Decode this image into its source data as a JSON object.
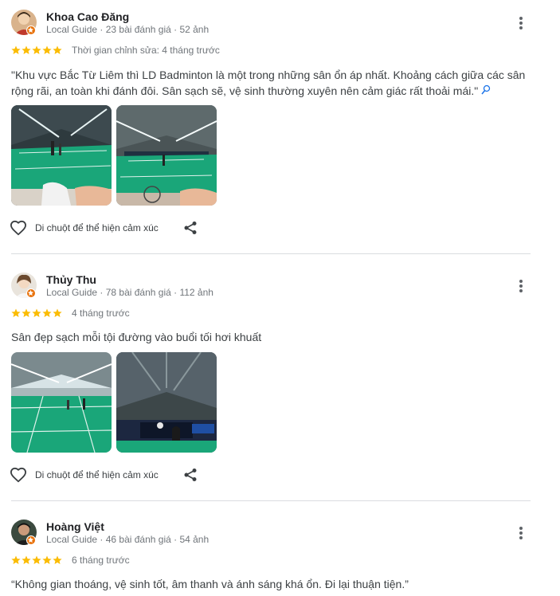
{
  "reviews": [
    {
      "name": "Khoa Cao Đăng",
      "meta": "Local Guide · 23 bài đánh giá · 52 ảnh",
      "rating": 5,
      "time": "Thời gian chỉnh sửa: 4 tháng trước",
      "text": "\"Khu vực Bắc Từ Liêm thì LD Badminton là một trong những sân ổn áp nhất. Khoảng cách giữa các sân rộng rãi, an toàn khi đánh đôi. Sân sạch sẽ, vệ sinh thường xuyên nên cảm giác rất thoải mái.\"",
      "like_label": "Di chuột để thể hiện cảm xúc"
    },
    {
      "name": "Thủy Thu",
      "meta": "Local Guide · 78 bài đánh giá · 112 ảnh",
      "rating": 5,
      "time": "4 tháng trước",
      "text": "Sân đẹp sạch mỗi tội đường vào buổi tối hơi khuất",
      "like_label": "Di chuột để thể hiện cảm xúc"
    },
    {
      "name": "Hoàng Việt",
      "meta": "Local Guide · 46 bài đánh giá · 54 ảnh",
      "rating": 5,
      "time": "6 tháng trước",
      "text": "“Không gian thoáng, vệ sinh tốt, âm thanh và ánh sáng khá ổn. Đi lại thuận tiện.”"
    }
  ],
  "colors": {
    "star": "#fbbc04",
    "guide_badge": "#e8710a",
    "court_green": "#1aa679",
    "divider": "#dadce0"
  },
  "icons": [
    "more-vert-icon",
    "star-icon",
    "translate-icon",
    "heart-outline-icon",
    "share-icon",
    "local-guide-badge-icon"
  ]
}
